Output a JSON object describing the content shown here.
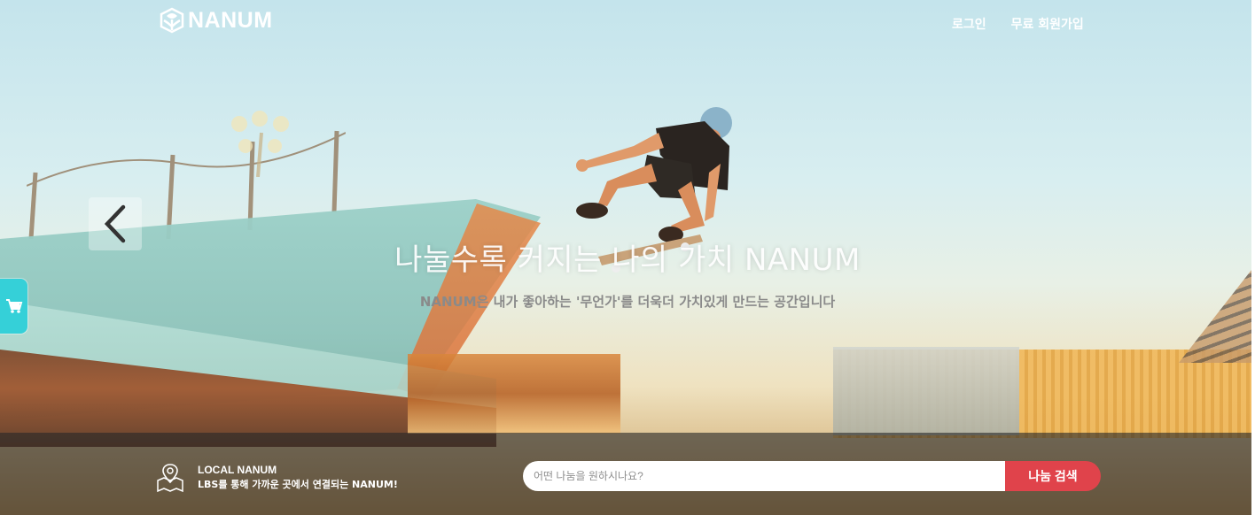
{
  "header": {
    "logo_text": "NANUM",
    "nav": {
      "login": "로그인",
      "signup": "무료 회원가입"
    }
  },
  "hero": {
    "headline": "나눌수록 커지는 나의 가치 NANUM",
    "subline": "NANUM은 내가 좋아하는 '무언가'를 더욱더 가치있게 만드는 공간입니다"
  },
  "bottom_bar": {
    "local_title": "LOCAL NANUM",
    "local_desc": "LBS를 통해 가까운 곳에서 연결되는 NANUM!",
    "search_placeholder": "어떤 나눔을 원하시나요?",
    "search_button": "나눔 검색"
  },
  "icons": {
    "logo": "leaf-box-icon",
    "prev": "chevron-left-icon",
    "cart": "cart-icon",
    "map": "map-pin-icon"
  },
  "colors": {
    "accent_red": "#e0434b",
    "cart_tab": "#35d0d8"
  }
}
